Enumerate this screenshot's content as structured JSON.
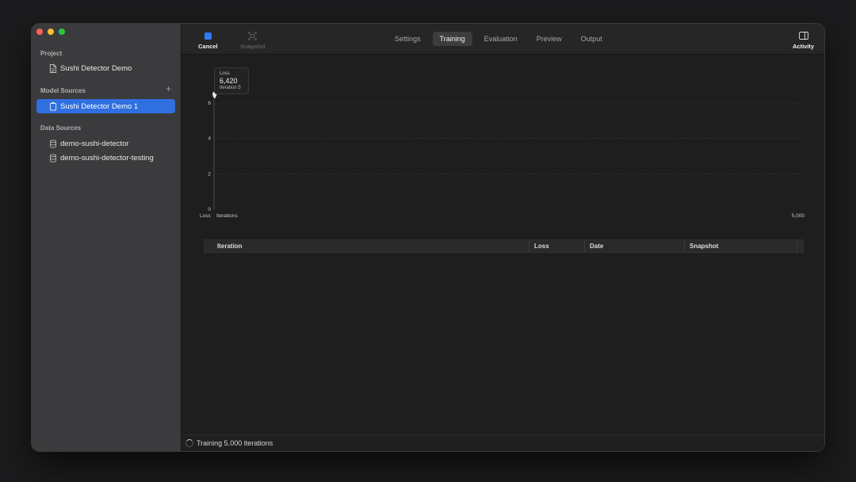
{
  "sidebar": {
    "project_title": "Project",
    "project_item": "Sushi Detector Demo",
    "model_sources_title": "Model Sources",
    "add_label": "+",
    "model_item": "Sushi Detector Demo 1",
    "data_sources_title": "Data Sources",
    "data_items": [
      "demo-sushi-detector",
      "demo-sushi-detector-testing"
    ]
  },
  "toolbar": {
    "cancel_label": "Cancel",
    "snapshot_label": "Snapshot",
    "activity_label": "Activity",
    "tabs": [
      "Settings",
      "Training",
      "Evaluation",
      "Preview",
      "Output"
    ],
    "active_tab": "Training"
  },
  "tooltip": {
    "title": "Loss",
    "value": "6,420",
    "subtitle": "Iteration 5"
  },
  "chart_data": {
    "type": "line",
    "xlabel": "Iterations",
    "ylabel": "Loss",
    "xlim": [
      0,
      5000
    ],
    "ylim": [
      0,
      6
    ],
    "y_ticks": [
      "0",
      "2",
      "4",
      "6"
    ],
    "x_tick_max_label": "5,000",
    "grid": true,
    "series": [
      {
        "x": [
          5
        ],
        "y": [
          6.42
        ]
      }
    ],
    "colors": {
      "grid": "#3a3a3a",
      "point": "#e8e8e8"
    }
  },
  "table": {
    "columns": [
      "Iteration",
      "Loss",
      "Date",
      "Snapshot"
    ]
  },
  "status": {
    "text": "Training 5.000 iterations"
  },
  "colors": {
    "accent": "#2f6fe0",
    "cancel_icon": "#2f7bf5"
  }
}
